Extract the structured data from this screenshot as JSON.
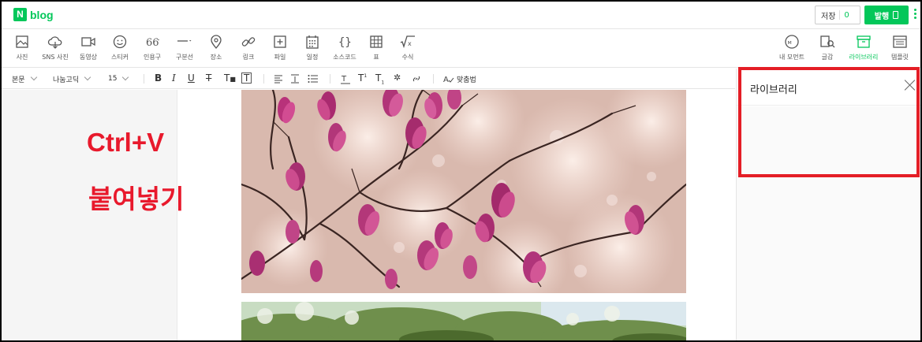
{
  "topbar": {
    "logo_mark": "N",
    "logo_text": "blog",
    "save_label": "저장",
    "save_count": "0",
    "publish_label": "발행"
  },
  "toolbar": {
    "left_tools": [
      {
        "icon": "photo-icon",
        "label": "사진"
      },
      {
        "icon": "cloud-icon",
        "label": "SNS 사진"
      },
      {
        "icon": "video-icon",
        "label": "동영상"
      },
      {
        "icon": "sticker-icon",
        "label": "스티커"
      },
      {
        "icon": "quote-icon",
        "label": "인용구"
      },
      {
        "icon": "divider-icon",
        "label": "구분선"
      },
      {
        "icon": "place-icon",
        "label": "장소"
      },
      {
        "icon": "link-icon",
        "label": "링크"
      },
      {
        "icon": "file-icon",
        "label": "파일"
      },
      {
        "icon": "calendar-icon",
        "label": "일정"
      },
      {
        "icon": "code-icon",
        "label": "소스코드"
      },
      {
        "icon": "table-icon",
        "label": "표"
      },
      {
        "icon": "formula-icon",
        "label": "수식"
      }
    ],
    "right_tools": [
      {
        "icon": "my-moment-icon",
        "label": "내 모먼트"
      },
      {
        "icon": "writing-icon",
        "label": "글감"
      },
      {
        "icon": "library-icon",
        "label": "라이브러리"
      },
      {
        "icon": "template-icon",
        "label": "템플릿"
      }
    ]
  },
  "format_bar": {
    "style": "본문",
    "font": "나눔고딕",
    "size": "15",
    "spellcheck": "맞춤법"
  },
  "annotation": {
    "line1": "Ctrl+V",
    "line2": "붙여넣기"
  },
  "side_panel": {
    "title": "라이브러리"
  },
  "colors": {
    "brand": "#03c75a",
    "annotation_red": "#e8192c"
  }
}
